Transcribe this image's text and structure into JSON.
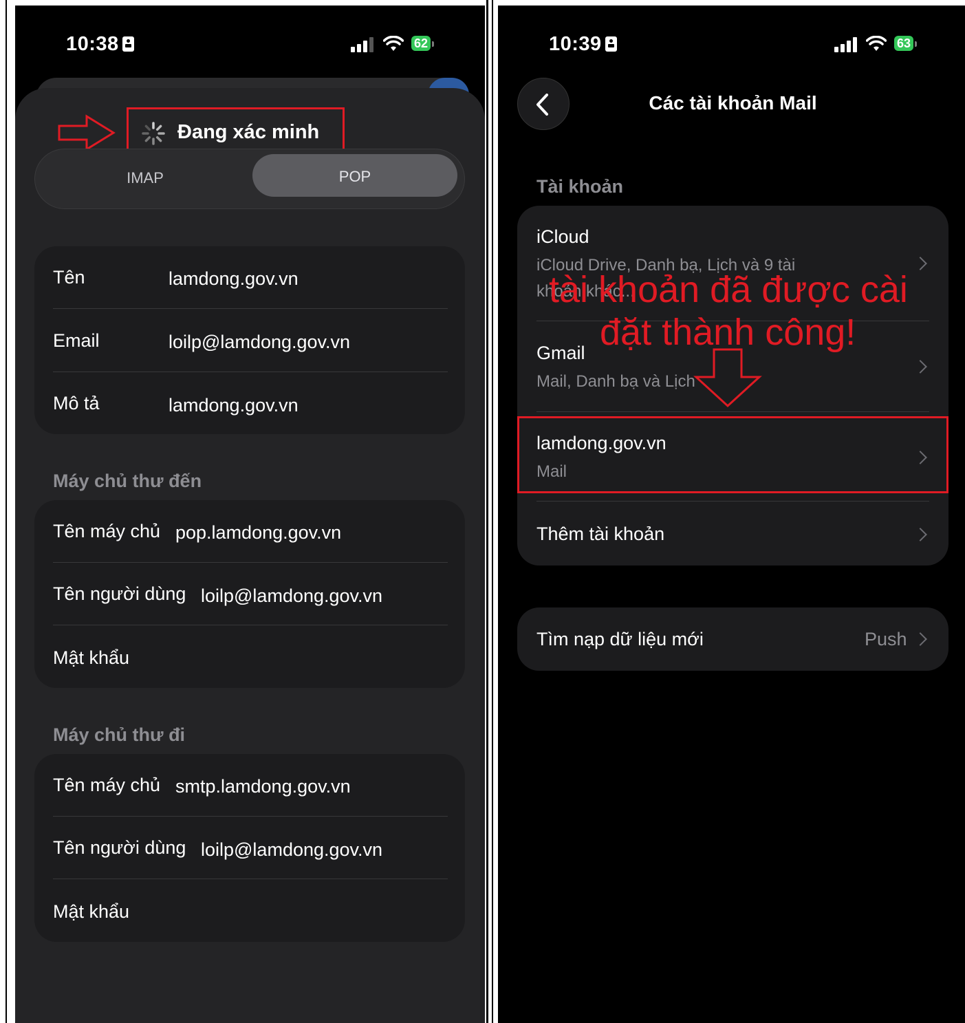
{
  "left": {
    "status": {
      "time": "10:38",
      "battery": "62"
    },
    "verify": {
      "label": "Đang xác minh"
    },
    "segment": {
      "imap": "IMAP",
      "pop": "POP",
      "selected": "POP"
    },
    "info": {
      "name_label": "Tên",
      "name_value": "lamdong.gov.vn",
      "email_label": "Email",
      "email_value": "loilp@lamdong.gov.vn",
      "desc_label": "Mô tả",
      "desc_value": "lamdong.gov.vn"
    },
    "incoming": {
      "title": "Máy chủ thư đến",
      "host_label": "Tên máy chủ",
      "host_value": "pop.lamdong.gov.vn",
      "user_label": "Tên người dùng",
      "user_value": "loilp@lamdong.gov.vn",
      "pass_label": "Mật khẩu"
    },
    "outgoing": {
      "title": "Máy chủ thư đi",
      "host_label": "Tên máy chủ",
      "host_value": "smtp.lamdong.gov.vn",
      "user_label": "Tên người dùng",
      "user_value": "loilp@lamdong.gov.vn",
      "pass_label": "Mật khẩu"
    }
  },
  "right": {
    "status": {
      "time": "10:39",
      "battery": "63"
    },
    "nav": {
      "title": "Các tài khoản Mail"
    },
    "accounts_header": "Tài khoản",
    "accounts": [
      {
        "name": "iCloud",
        "detail_line1": "iCloud Drive, Danh bạ, Lịch và 9 tài",
        "detail_line2": "khoản khác..."
      },
      {
        "name": "Gmail",
        "detail": "Mail, Danh bạ và Lịch"
      },
      {
        "name": "lamdong.gov.vn",
        "detail": "Mail"
      },
      {
        "name": "Thêm tài khoản"
      }
    ],
    "fetch": {
      "label": "Tìm nạp dữ liệu mới",
      "value": "Push"
    },
    "annotation": {
      "line1": "tài khoản đã được cài",
      "line2": "đặt thành công!"
    }
  },
  "colors": {
    "annotation_red": "#e01b24",
    "battery_green": "#34c759",
    "card_bg": "#1c1c1e"
  }
}
